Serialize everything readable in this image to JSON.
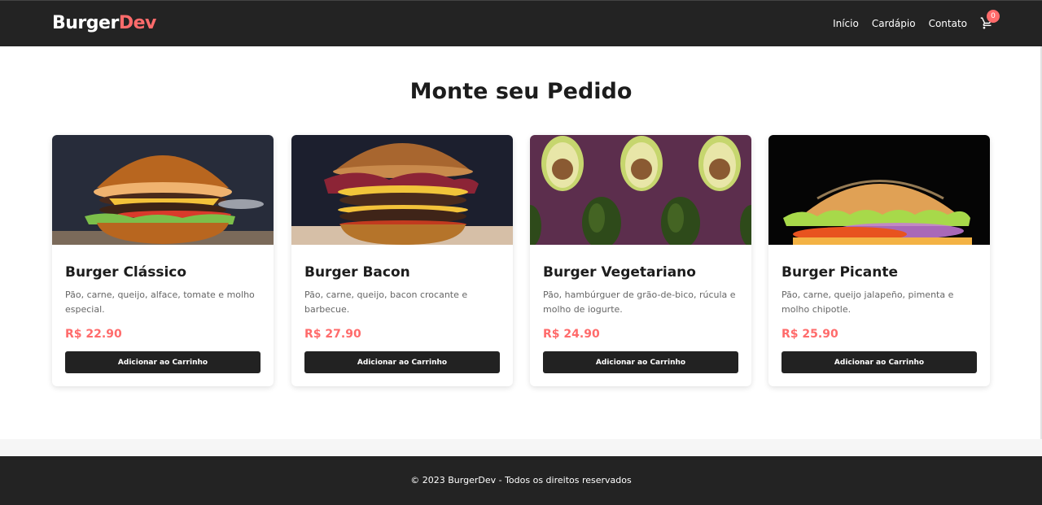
{
  "brand": {
    "part1": "Burger",
    "part2": "Dev"
  },
  "nav": {
    "links": [
      "Início",
      "Cardápio",
      "Contato"
    ],
    "cart_count": "0"
  },
  "page": {
    "title": "Monte seu Pedido"
  },
  "products": [
    {
      "name": "Burger Clássico",
      "description": "Pão, carne, queijo, alface, tomate e molho especial.",
      "price": "R$ 22.90",
      "button": "Adicionar ao Carrinho",
      "image": "classic-burger-photo"
    },
    {
      "name": "Burger Bacon",
      "description": "Pão, carne, queijo, bacon crocante e barbecue.",
      "price": "R$ 27.90",
      "button": "Adicionar ao Carrinho",
      "image": "bacon-burger-photo"
    },
    {
      "name": "Burger Vegetariano",
      "description": "Pão, hambúrguer de grão-de-bico, rúcula e molho de iogurte.",
      "price": "R$ 24.90",
      "button": "Adicionar ao Carrinho",
      "image": "avocado-photo"
    },
    {
      "name": "Burger Picante",
      "description": "Pão, carne, queijo jalapeño, pimenta e molho chipotle.",
      "price": "R$ 25.90",
      "button": "Adicionar ao Carrinho",
      "image": "spicy-burger-photo"
    }
  ],
  "footer": {
    "text": "© 2023 BurgerDev - Todos os direitos reservados"
  },
  "colors": {
    "accent": "#ff6b6b",
    "dark": "#232323"
  }
}
